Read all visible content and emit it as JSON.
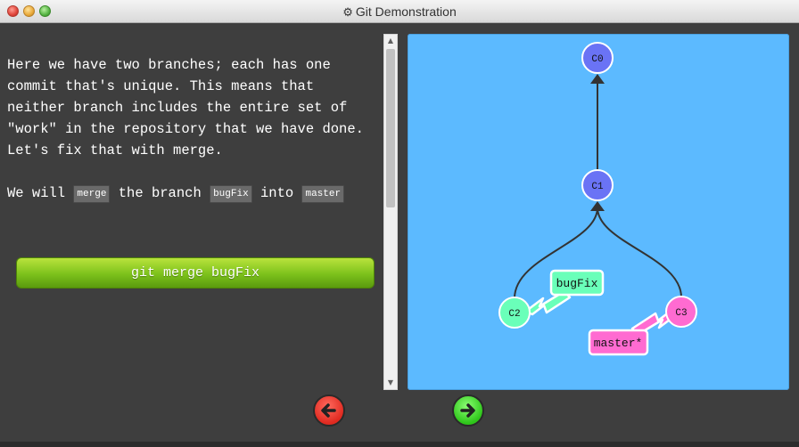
{
  "window": {
    "title": "Git Demonstration",
    "gear_glyph": "⚙"
  },
  "instructions": {
    "paragraph1": "Here we have two branches; each has one commit that's unique. This means that neither branch includes the entire set of \"work\" in the repository that we have done. Let's fix that with merge.",
    "paragraph2_a": "We will ",
    "paragraph2_code1": "merge",
    "paragraph2_b": " the branch ",
    "paragraph2_code2": "bugFix",
    "paragraph2_c": " into ",
    "paragraph2_code3": "master"
  },
  "command_button": {
    "label": "git merge bugFix"
  },
  "graph": {
    "background_color": "#5cbaff",
    "commits": [
      {
        "id": "C0",
        "color": "#6a73f5"
      },
      {
        "id": "C1",
        "color": "#6a73f5"
      },
      {
        "id": "C2",
        "color": "#6affb9"
      },
      {
        "id": "C3",
        "color": "#ff6bd1"
      }
    ],
    "branches": [
      {
        "name": "bugFix",
        "color": "#6affb9",
        "target": "C2"
      },
      {
        "name": "master*",
        "color": "#ff6bd1",
        "target": "C3"
      }
    ]
  },
  "navigation": {
    "back_icon": "arrow-left-icon",
    "forward_icon": "arrow-right-icon",
    "back_color": "#e02a20",
    "forward_color": "#2ec61a"
  }
}
